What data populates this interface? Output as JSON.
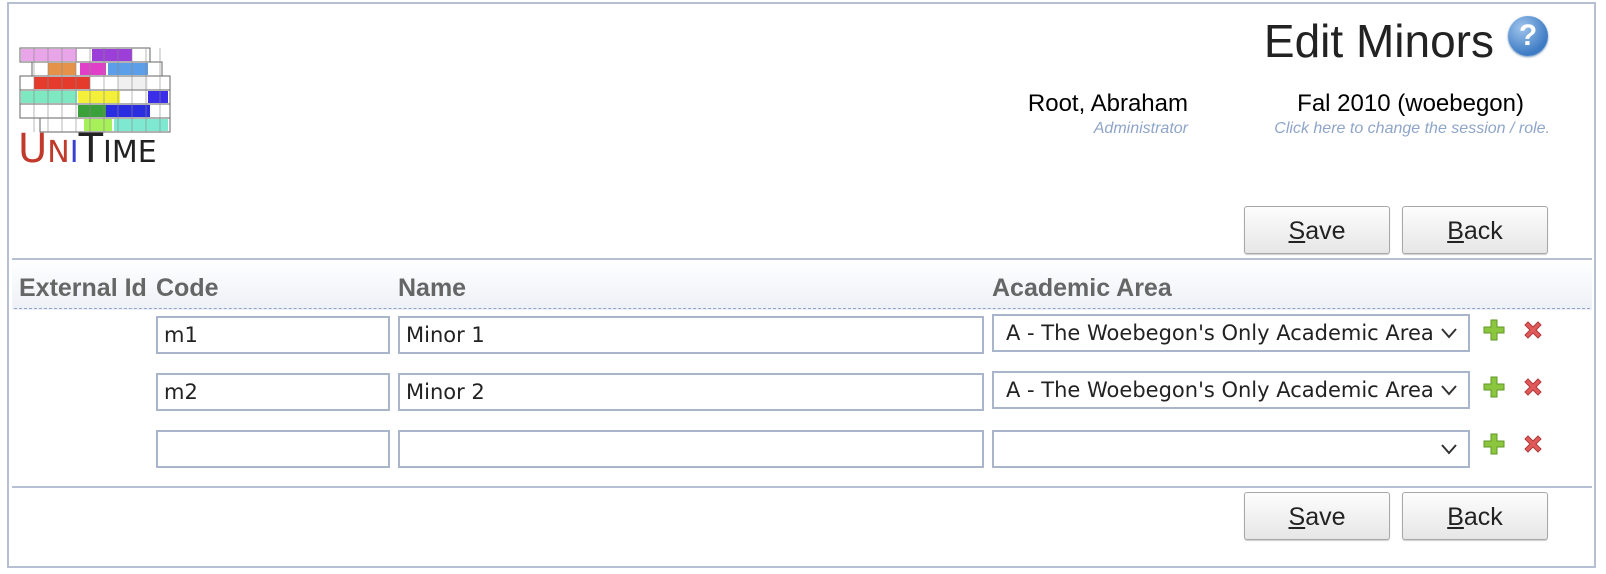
{
  "page": {
    "title": "Edit Minors"
  },
  "brand": {
    "part1": "U",
    "part2": "N",
    "part3": "I",
    "part4": "T",
    "part5": "IME"
  },
  "help": {
    "icon": "help-icon",
    "glyph": "?"
  },
  "user": {
    "name": "Root, Abraham",
    "role": "Administrator"
  },
  "session": {
    "name": "Fal 2010 (woebegon)",
    "hint": "Click here to change the session / role."
  },
  "buttons": {
    "save": "ave",
    "save_key": "S",
    "back": "ack",
    "back_key": "B"
  },
  "table": {
    "headers": {
      "external_id": "External Id",
      "code": "Code",
      "name": "Name",
      "academic_area": "Academic Area"
    },
    "rows": [
      {
        "code": "m1",
        "name": "Minor 1",
        "academic_area": "A - The Woebegon's Only Academic Area"
      },
      {
        "code": "m2",
        "name": "Minor 2",
        "academic_area": "A - The Woebegon's Only Academic Area"
      },
      {
        "code": "",
        "name": "",
        "academic_area": ""
      }
    ]
  },
  "colors": {
    "add": "#8cc63f",
    "delete": "#e05a5a",
    "border": "#b7c0d2",
    "muted": "#8fa5c8"
  }
}
